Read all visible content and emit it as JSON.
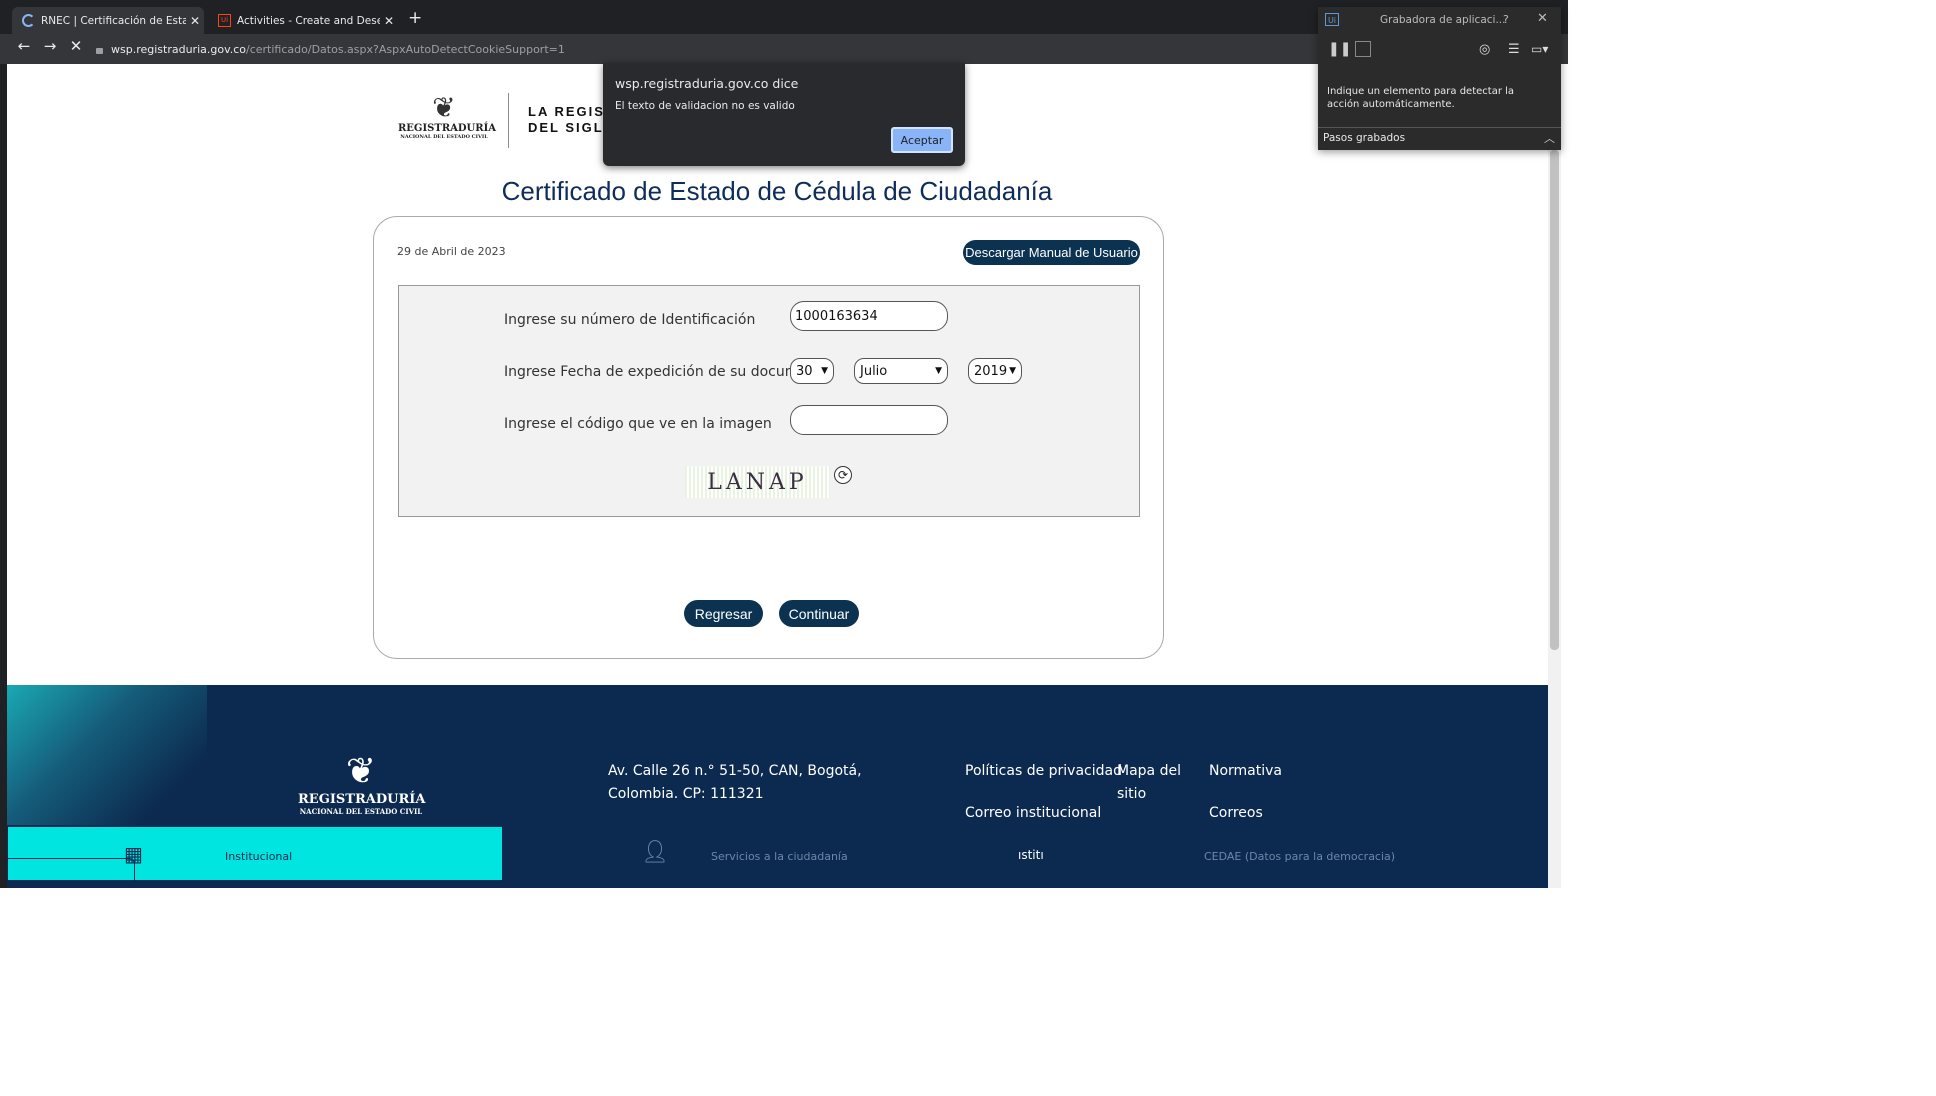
{
  "browser": {
    "tabs": [
      {
        "title": "RNEC | Certificación de Estado de Cédula",
        "icon": "loading-spinner-icon",
        "close": "✕"
      },
      {
        "title": "Activities - Create and Deserialize",
        "icon": "uipath-icon",
        "close": "✕"
      }
    ],
    "new_tab": "+",
    "url_host": "wsp.registraduria.gov.co",
    "url_path": "/certificado/Datos.aspx?AspxAutoDetectCookieSupport=1"
  },
  "header": {
    "logo_name": "REGISTRADURÍA",
    "logo_sub": "NACIONAL DEL ESTADO CIVIL",
    "tagline_line1": "LA REGISTR",
    "tagline_line2": "DEL SIGLO X"
  },
  "page": {
    "title": "Certificado de Estado de Cédula de Ciudadanía",
    "date": "29 de Abril de 2023",
    "manual_button": "Descargar Manual de Usuario"
  },
  "form": {
    "id_label": "Ingrese su número de Identificación",
    "id_value": "1000163634",
    "date_label": "Ingrese Fecha de expedición de su documento",
    "day": "30",
    "month": "Julio",
    "year": "2019",
    "code_label": "Ingrese el código que ve en la imagen",
    "code_value": "",
    "captcha_text": "LANAP"
  },
  "actions": {
    "back": "Regresar",
    "continue": "Continuar"
  },
  "footer": {
    "logo_name": "REGISTRADURÍA",
    "logo_sub": "NACIONAL DEL ESTADO CIVIL",
    "address": "Av. Calle 26 n.° 51-50, CAN, Bogotá, Colombia. CP: 111321",
    "links": {
      "privacy": "Políticas de privacidad",
      "sitemap": "Mapa del sitio",
      "normativa": "Normativa",
      "correo_inst": "Correo institucional",
      "correos": "Correos"
    },
    "bottom": {
      "institucional": "Institucional",
      "servicios": "Servicios a la ciudadanía",
      "inst_trunc": "ıstitı",
      "cedae": "CEDAE (Datos para la democracia)"
    }
  },
  "dialog": {
    "title": "wsp.registraduria.gov.co dice",
    "message": "El texto de validacion no es valido",
    "ok": "Aceptar"
  },
  "recorder": {
    "title": "Grabadora de aplicaci...",
    "help": "?",
    "close": "✕",
    "instruction": "Indique un elemento para detectar la acción automáticamente.",
    "steps_label": "Pasos grabados"
  }
}
